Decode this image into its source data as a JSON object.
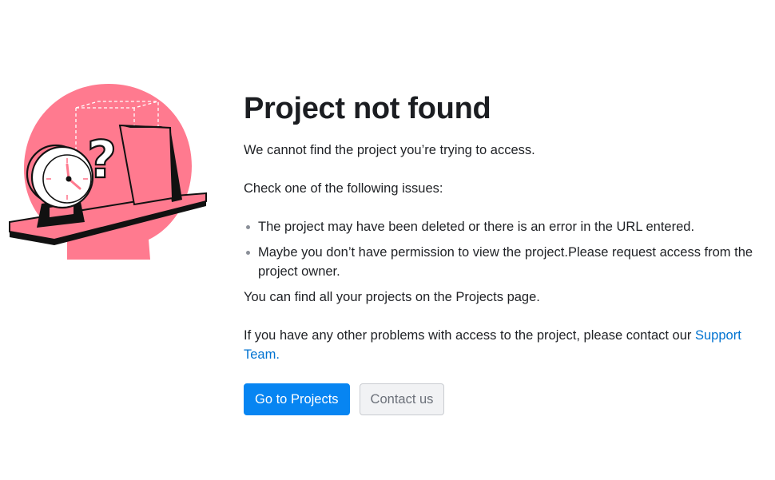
{
  "illustration": {
    "name": "project-not-found-illustration",
    "colors": {
      "accent": "#ff7a8f",
      "outline": "#111111",
      "dashed": "#ffffff"
    }
  },
  "content": {
    "title": "Project not found",
    "intro": "We cannot find the project you’re trying to access.",
    "check_heading": "Check one of the following issues:",
    "issues": [
      "The project may have been deleted or there is an error in the URL entered.",
      "Maybe you don’t have permission to view the project.Please request access from the project owner."
    ],
    "projects_note": "You can find all your projects on the Projects page.",
    "support_prefix": "If you have any other problems with access to the project, please contact our ",
    "support_link": "Support Team."
  },
  "buttons": {
    "primary_label": "Go to Projects",
    "secondary_label": "Contact us"
  },
  "colors": {
    "primary": "#0785f2",
    "link": "#0073d1",
    "text": "#1f2125"
  }
}
